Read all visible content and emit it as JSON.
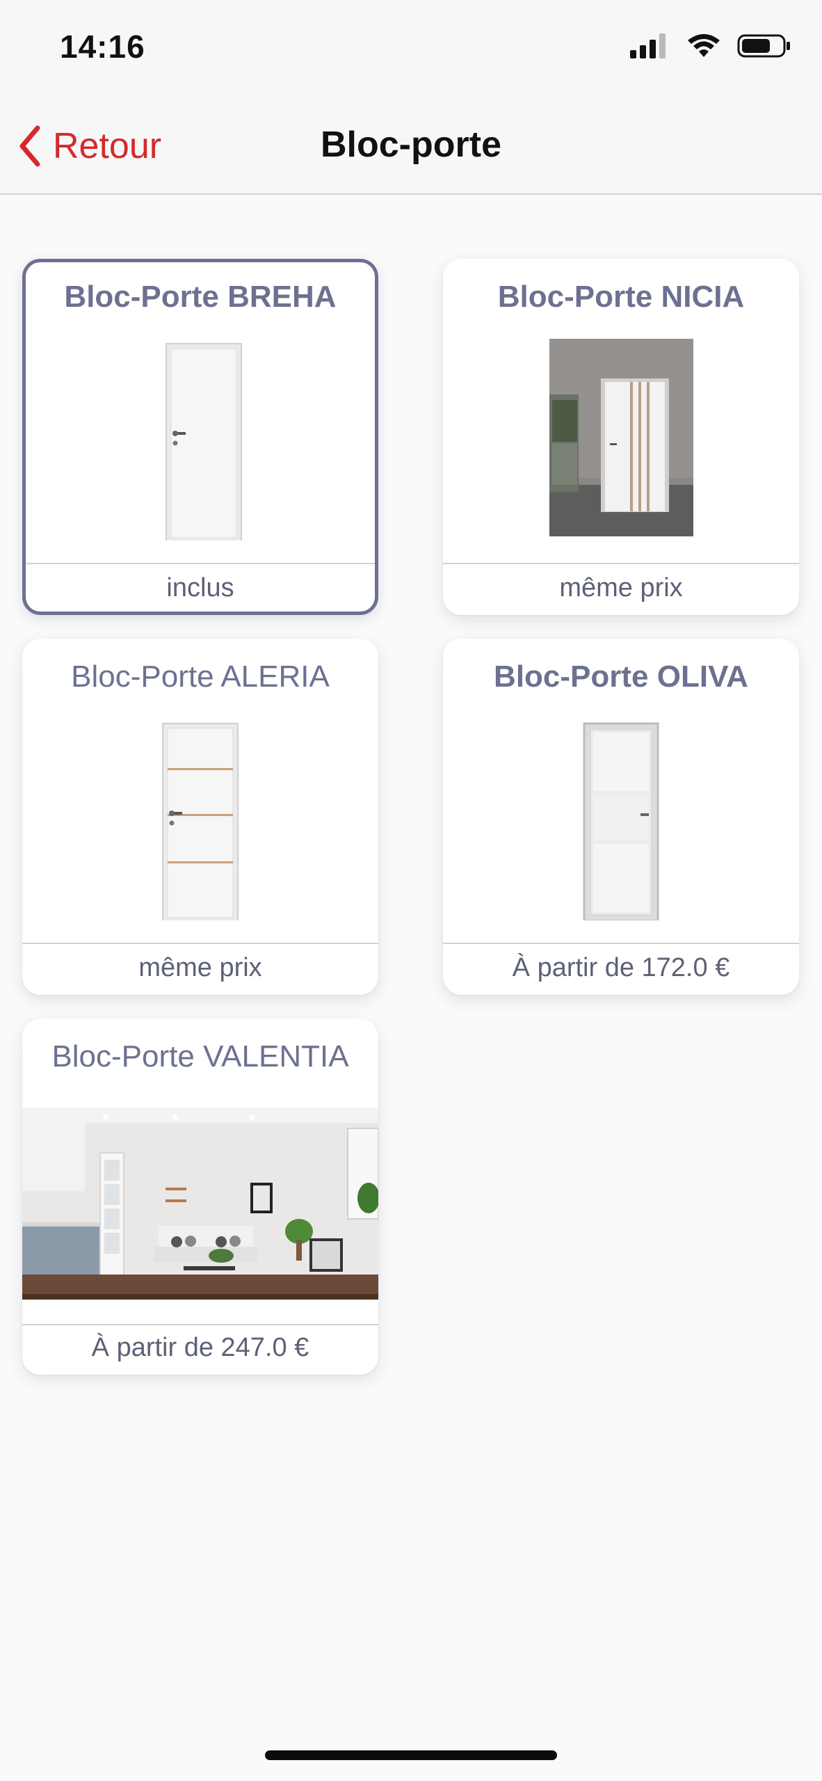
{
  "status": {
    "time": "14:16"
  },
  "nav": {
    "back_label": "Retour",
    "title": "Bloc-porte"
  },
  "products": [
    {
      "name": "Bloc-Porte BREHA",
      "price": "inclus",
      "selected": true,
      "image": "door-plain-icon"
    },
    {
      "name": "Bloc-Porte NICIA",
      "price": "même prix",
      "selected": false,
      "image": "door-room-photo"
    },
    {
      "name": "Bloc-Porte ALERIA",
      "price": "même prix",
      "selected": false,
      "image": "door-striped-icon"
    },
    {
      "name": "Bloc-Porte OLIVA",
      "price": "À partir de 172.0 €",
      "selected": false,
      "image": "door-glass-icon"
    },
    {
      "name": "Bloc-Porte VALENTIA",
      "price": "À partir de 247.0 €",
      "selected": false,
      "image": "living-room-photo"
    }
  ],
  "colors": {
    "accent": "#d42a2a",
    "card_text": "#6c7190",
    "background": "#fafafb"
  }
}
